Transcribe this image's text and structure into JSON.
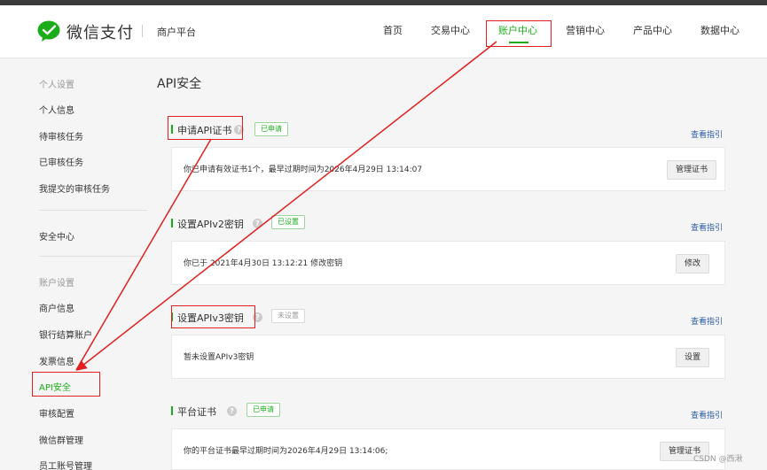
{
  "header": {
    "logo_text": "微信支付",
    "merchant_label": "商户平台",
    "nav": [
      "首页",
      "交易中心",
      "账户中心",
      "营销中心",
      "产品中心",
      "数据中心"
    ],
    "active_nav": "账户中心"
  },
  "sidebar": {
    "personal_title": "个人设置",
    "personal_items": [
      "个人信息",
      "待审核任务",
      "已审核任务",
      "我提交的审核任务"
    ],
    "security_item": "安全中心",
    "account_title": "账户设置",
    "account_items": [
      "商户信息",
      "银行结算账户",
      "发票信息",
      "API安全",
      "审核配置",
      "微信群管理",
      "员工账号管理"
    ],
    "active_item": "API安全"
  },
  "main": {
    "title": "API安全",
    "sections": [
      {
        "title": "申请API证书",
        "badge": "已申请",
        "badge_color": "#1aad19",
        "guide": "查看指引",
        "text": "你已申请有效证书1个，最早过期时间为2026年4月29日 13:14:07",
        "button": "管理证书"
      },
      {
        "title": "设置APIv2密钥",
        "badge": "已设置",
        "badge_color": "#1aad19",
        "guide": "查看指引",
        "text": "你已于 2021年4月30日 13:12:21 修改密钥",
        "button": "修改"
      },
      {
        "title": "设置APIv3密钥",
        "badge": "未设置",
        "badge_color": "#999999",
        "guide": "查看指引",
        "text": "暂未设置APIv3密钥",
        "button": "设置"
      },
      {
        "title": "平台证书",
        "badge": "已申请",
        "badge_color": "#1aad19",
        "guide": "查看指引",
        "text": "你的平台证书最早过期时间为2026年4月29日 13:14:06;",
        "button": "管理证书"
      }
    ]
  },
  "watermark": "CSDN @西湫",
  "colors": {
    "accent": "#1aad19",
    "annotation": "#e02020",
    "link": "#2a5caa"
  }
}
